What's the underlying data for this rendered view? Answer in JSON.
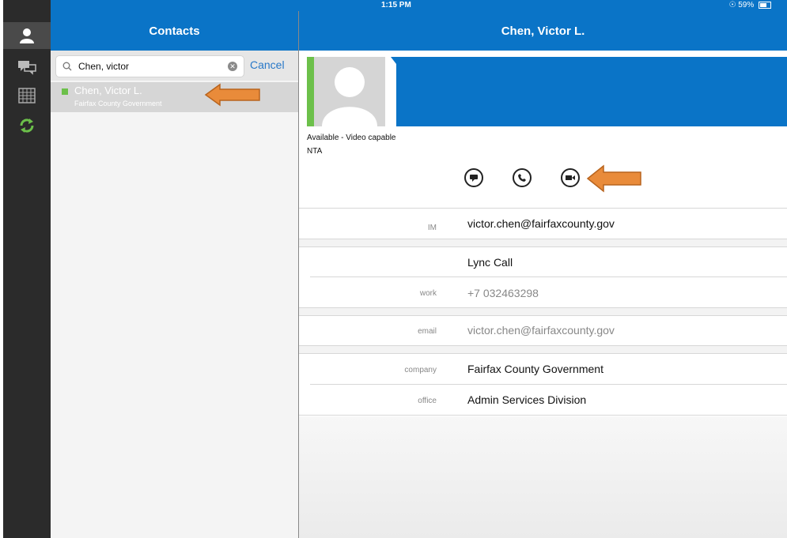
{
  "status_bar": {
    "device": "iPad",
    "time": "1:15 PM",
    "battery": "59%"
  },
  "rail": {
    "items": [
      {
        "icon": "contacts-icon"
      },
      {
        "icon": "conversations-icon"
      },
      {
        "icon": "calendar-icon"
      },
      {
        "icon": "sync-icon"
      }
    ]
  },
  "contacts": {
    "title": "Contacts",
    "search_value": "Chen, victor",
    "cancel_label": "Cancel",
    "results": [
      {
        "name": "Chen, Victor L.",
        "organization": "Fairfax County Government",
        "presence": "available"
      }
    ]
  },
  "detail": {
    "title": "Chen, Victor L.",
    "status": "Available - Video capable",
    "department": "NTA",
    "actions": [
      "im-icon",
      "phone-icon",
      "video-icon"
    ],
    "fields": {
      "im_label": "IM",
      "im_value": "victor.chen@fairfaxcounty.gov",
      "lync_call": "Lync Call",
      "work_label": "work",
      "work_value": "+7 032463298",
      "email_label": "email",
      "email_value": "victor.chen@fairfaxcounty.gov",
      "company_label": "company",
      "company_value": "Fairfax County Government",
      "office_label": "office",
      "office_value": "Admin Services Division"
    }
  },
  "colors": {
    "brand_blue": "#0a74c7",
    "presence_green": "#6cc04a",
    "annotation_orange": "#e98b3a"
  }
}
